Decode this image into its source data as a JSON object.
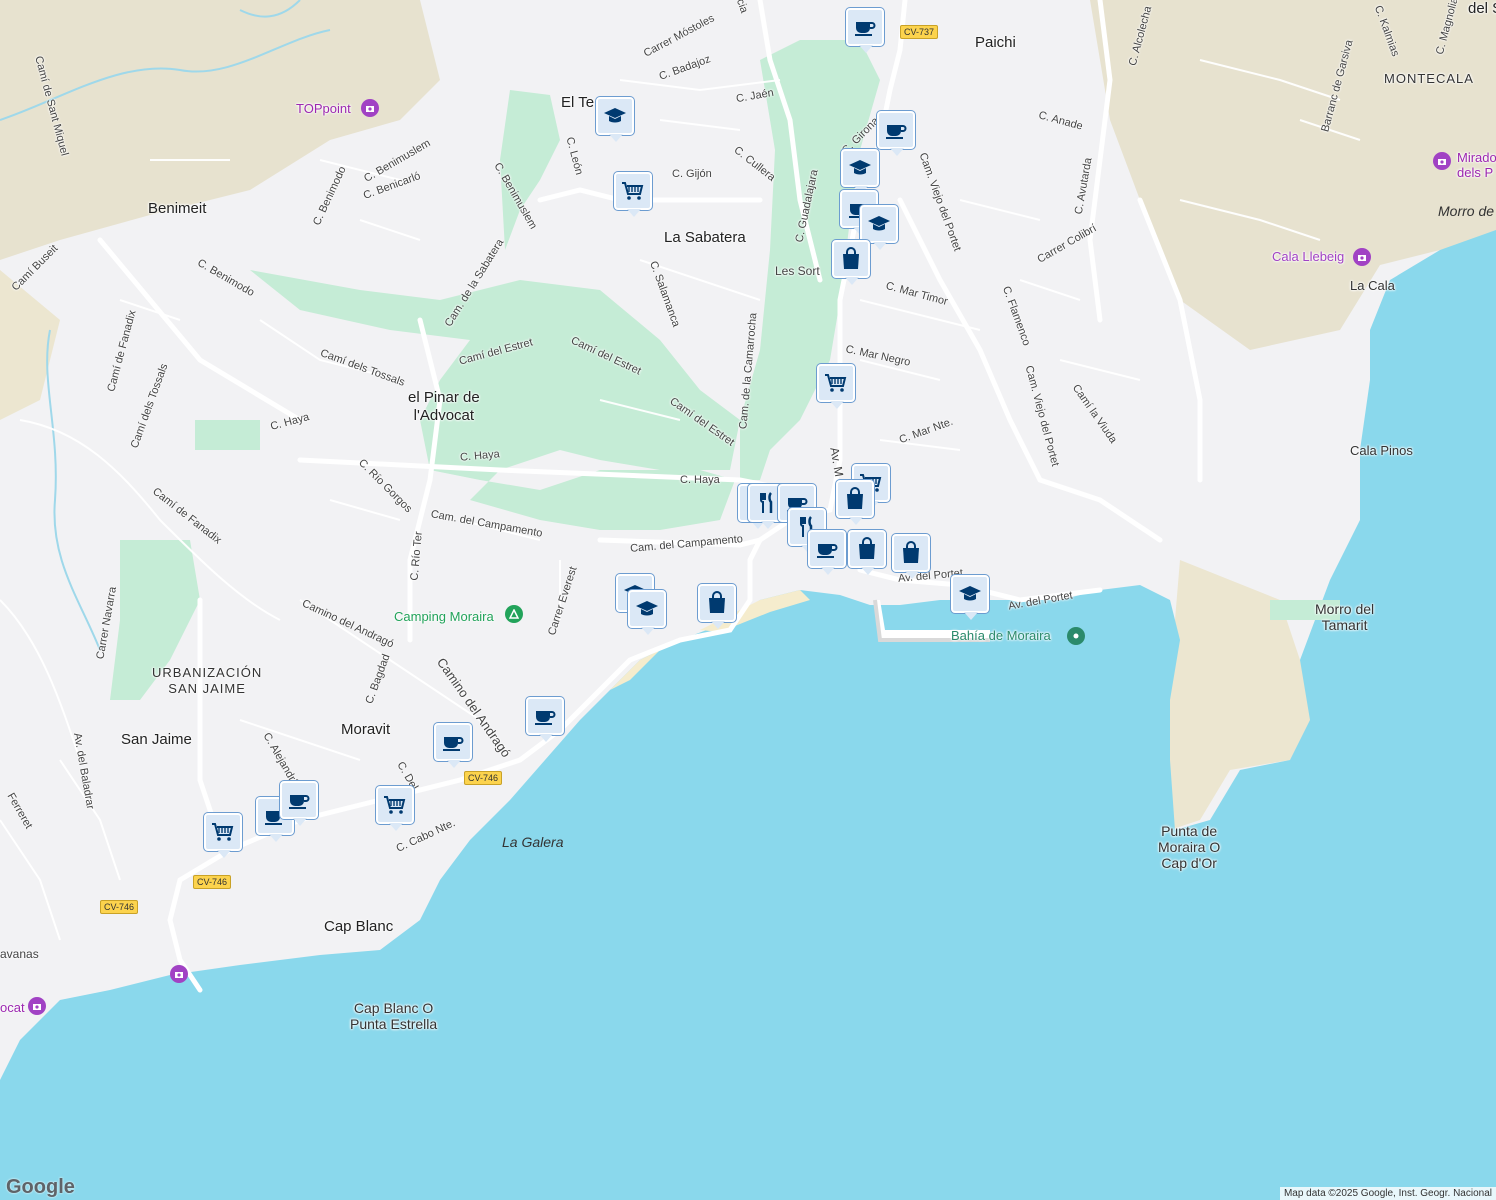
{
  "colors": {
    "sea": "#8ad8ec",
    "land": "#f2f2f4",
    "terrain": "#e8e4d4",
    "park": "#c5ecd6",
    "road": "#ffffff",
    "highway": "#fcd34d",
    "marker_bg": "#dbe8f6",
    "marker_icon": "#003a70",
    "poi_purple": "#a142c4",
    "poi_green": "#22a35a"
  },
  "places": {
    "paichi": "Paichi",
    "montecala": "MONTECALA",
    "el_tesoro": "El Te",
    "benimeit": "Benimeit",
    "la_sabatera": "La Sabatera",
    "les_sort": "Les Sort",
    "el_pinar": "el Pinar de\nl'Advocat",
    "urbanizacion": "URBANIZACIÓN\nSAN JAIME",
    "moravit": "Moravit",
    "san_jaime": "San Jaime",
    "cap_blanc": "Cap Blanc",
    "del_s": "del S"
  },
  "coast": {
    "la_cala": "La Cala",
    "cala_pinos": "Cala Pinos",
    "morro_tamarit": "Morro del\nTamarit",
    "punta_moraira": "Punta de\nMoraira O\nCap d'Or",
    "cap_blanc_punta": "Cap Blanc O\nPunta Estrella",
    "la_galera": "La Galera",
    "morro_de": "Morro de",
    "cala_llebeig": "Cala Llebeig",
    "bahia": "Bahía de Moraira"
  },
  "pois": {
    "toppoint": "TOPpoint",
    "camping": "Camping Moraira",
    "mirador": "Mirado\ndels P",
    "cavanas": "avanas",
    "ocat": "ocat"
  },
  "streets": {
    "s1": "Carrer Móstoles",
    "s2": "C. Badajoz",
    "s3": "C. Jaén",
    "s4": "C. Cullera",
    "s5": "C. Gijón",
    "s6": "C. León",
    "s7": "C. Guadalajara",
    "s8": "C. Girona",
    "s9": "Cam. Viejo del Portet",
    "s10": "C. Anade",
    "s11": "C. Alcolecha",
    "s12": "C. Avutarda",
    "s13": "Carrer Colibrí",
    "s14": "C. Mar Timor",
    "s15": "C. Flamenco",
    "s16": "C. Mar Negro",
    "s17": "Cam. Viejo del Portet",
    "s18": "Camí la Viuda",
    "s19": "C. Mar Nte.",
    "s20": "C. Salamanca",
    "s21": "Cam. de la Camarrocha",
    "s22": "Camí del Estret",
    "s23": "Camí del Estret",
    "s24": "Camí del Estret",
    "s25": "Cam. de la Sabatera",
    "s26": "C. Benimuslem",
    "s27": "C. Benimuslem",
    "s28": "C. Benicarló",
    "s29": "C. Benimodo",
    "s30": "C. Benimodo",
    "s31": "Camí de Sant Miquel",
    "s32": "Camí Buseit",
    "s33": "Camí de Fanadix",
    "s34": "Camí dels Tossals",
    "s35": "Camí dels Tossals",
    "s36": "C. Haya",
    "s37": "C. Haya",
    "s38": "C. Haya",
    "s39": "C. Río Gorgos",
    "s40": "Cam. del Campamento",
    "s41": "Cam. del Campamento",
    "s42": "C. Río Ter",
    "s43": "Camí de Fanadix",
    "s44": "Carrer Everest",
    "s45": "Carrer Navarra",
    "s46": "Camino del Andragó",
    "s47": "Camino del Andragó",
    "s48": "C. Bagdad",
    "s49": "C. Alejandría",
    "s50": "Av. del Baladrar",
    "s51": "Ferreret",
    "s52": "C. Cabo Nte.",
    "s53": "Av. del Portet",
    "s54": "Av. del Portet",
    "s55": "Av. M",
    "s56": "Barranc de Garsiva",
    "s57": "C. Kalmias",
    "s58": "C. Magnolia",
    "s59": "C. Del",
    "s60": "cia"
  },
  "shields": {
    "cv737": "CV-737",
    "cv746a": "CV-746",
    "cv746b": "CV-746",
    "cv746c": "CV-746"
  },
  "attribution": "Map data ©2025 Google, Inst. Geogr. Nacional",
  "logo": "Google",
  "markers": [
    {
      "type": "cafe"
    },
    {
      "type": "school"
    },
    {
      "type": "shop"
    },
    {
      "type": "cafe"
    },
    {
      "type": "school"
    },
    {
      "type": "cafe"
    },
    {
      "type": "school"
    },
    {
      "type": "bag"
    },
    {
      "type": "shop"
    },
    {
      "type": "restaurant"
    },
    {
      "type": "restaurant"
    },
    {
      "type": "cafe"
    },
    {
      "type": "shop"
    },
    {
      "type": "bag"
    },
    {
      "type": "restaurant"
    },
    {
      "type": "cafe"
    },
    {
      "type": "bag"
    },
    {
      "type": "bag"
    },
    {
      "type": "school"
    },
    {
      "type": "school"
    },
    {
      "type": "bag"
    },
    {
      "type": "cafe"
    },
    {
      "type": "cafe"
    },
    {
      "type": "cafe"
    },
    {
      "type": "cafe"
    },
    {
      "type": "shop"
    },
    {
      "type": "shop"
    },
    {
      "type": "school"
    }
  ]
}
